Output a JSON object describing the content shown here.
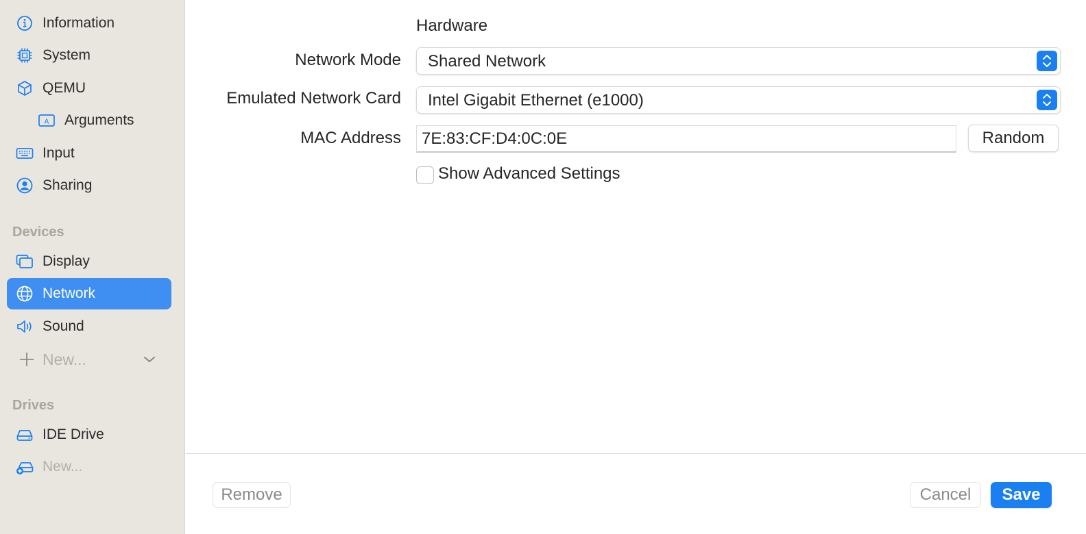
{
  "sidebar": {
    "items": [
      {
        "label": "Information",
        "icon": "info-circle-icon"
      },
      {
        "label": "System",
        "icon": "cpu-chip-icon"
      },
      {
        "label": "QEMU",
        "icon": "cube-icon"
      },
      {
        "label": "Arguments",
        "icon": "argument-box-icon"
      },
      {
        "label": "Input",
        "icon": "keyboard-icon"
      },
      {
        "label": "Sharing",
        "icon": "person-circle-icon"
      }
    ],
    "devices_heading": "Devices",
    "devices": [
      {
        "label": "Display",
        "icon": "display-windows-icon"
      },
      {
        "label": "Network",
        "icon": "globe-icon",
        "selected": true
      },
      {
        "label": "Sound",
        "icon": "speaker-icon"
      },
      {
        "label": "New...",
        "icon": "plus-icon"
      }
    ],
    "drives_heading": "Drives",
    "drives": [
      {
        "label": "IDE Drive",
        "icon": "drive-icon"
      },
      {
        "label": "New...",
        "icon": "add-drive-icon"
      }
    ]
  },
  "form": {
    "section_title": "Hardware",
    "network_mode_label": "Network Mode",
    "network_mode_value": "Shared Network",
    "card_label": "Emulated Network Card",
    "card_value": "Intel Gigabit Ethernet (e1000)",
    "mac_label": "MAC Address",
    "mac_value": "7E:83:CF:D4:0C:0E",
    "random_label": "Random",
    "advanced_label": "Show Advanced Settings",
    "advanced_checked": false
  },
  "footer": {
    "remove_label": "Remove",
    "cancel_label": "Cancel",
    "save_label": "Save"
  },
  "colors": {
    "accent": "#1a7ff0",
    "sidebar_bg": "#e9e6e0",
    "selected_bg": "#3f8ef2"
  }
}
